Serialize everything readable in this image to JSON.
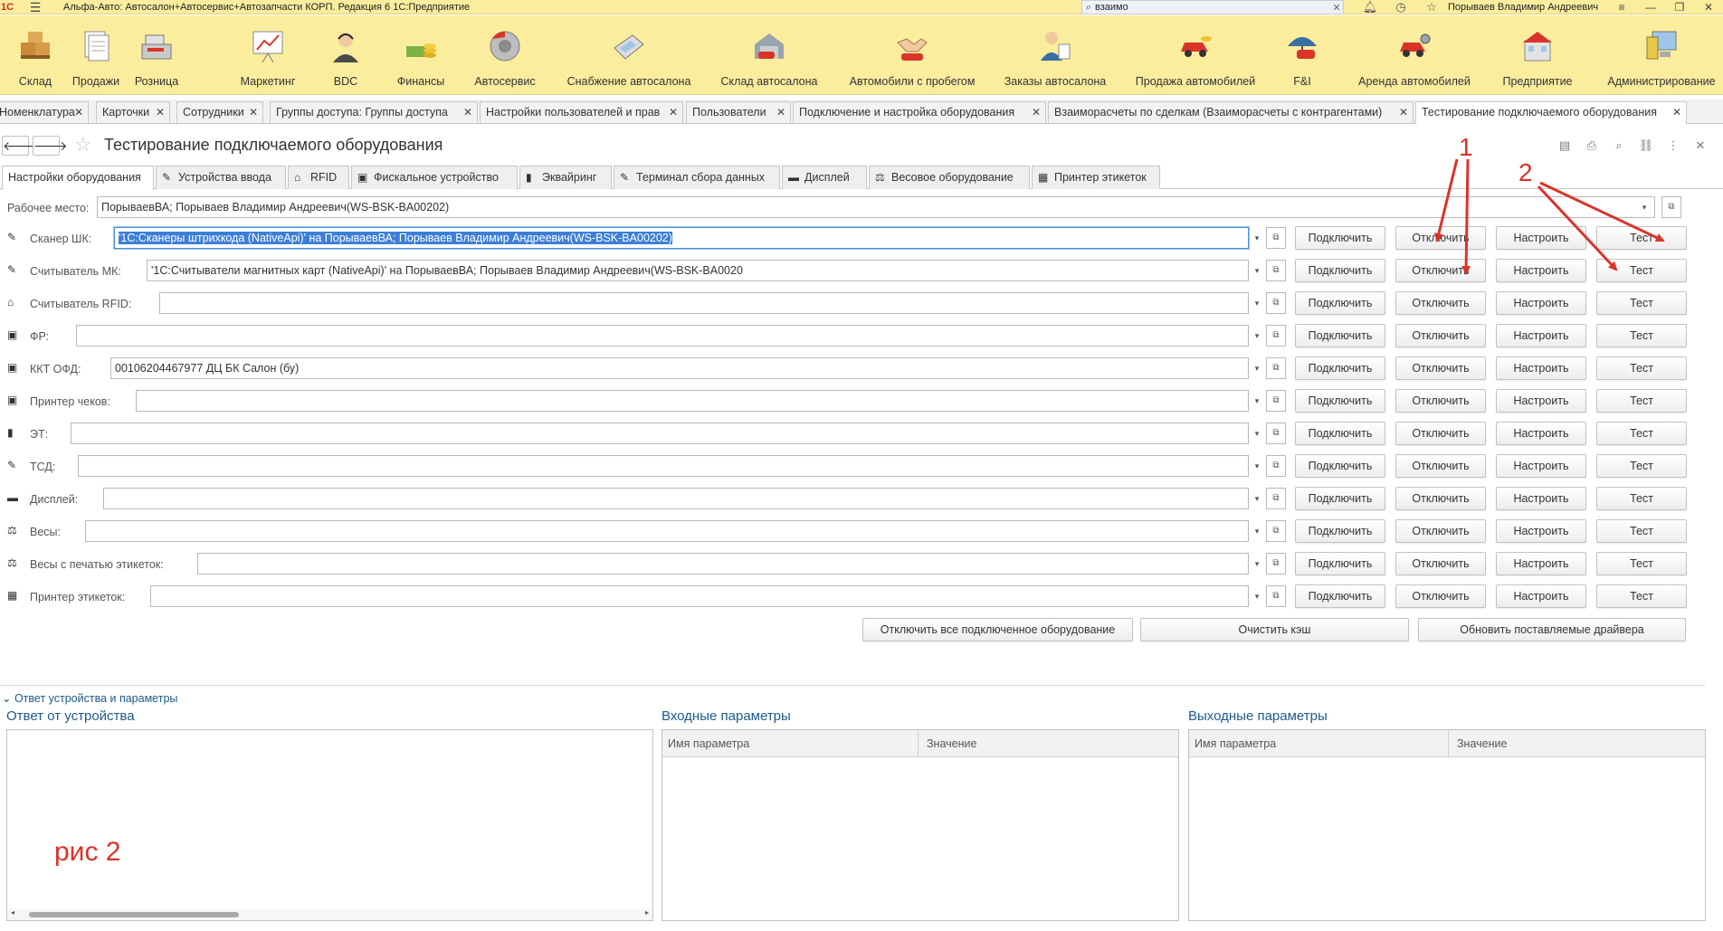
{
  "titlebar": {
    "logo": "1С",
    "title": "Альфа-Авто: Автосалон+Автосервис+Автозапчасти КОРП. Редакция 6 1С:Предприятие",
    "search_value": "взаимо",
    "user": "Порываев Владимир Андреевич"
  },
  "sections": [
    {
      "label": "Склад",
      "icon": "boxes-icon"
    },
    {
      "label": "Продажи",
      "icon": "documents-icon"
    },
    {
      "label": "Розница",
      "icon": "cash-register-icon"
    },
    {
      "label": "Маркетинг",
      "icon": "chart-board-icon"
    },
    {
      "label": "BDC",
      "icon": "operator-icon"
    },
    {
      "label": "Финансы",
      "icon": "coins-icon"
    },
    {
      "label": "Автосервис",
      "icon": "brake-disc-icon"
    },
    {
      "label": "Снабжение автосалона",
      "icon": "calculator-icon"
    },
    {
      "label": "Склад автосалона",
      "icon": "garage-icon"
    },
    {
      "label": "Автомобили с пробегом",
      "icon": "handshake-car-icon"
    },
    {
      "label": "Заказы автосалона",
      "icon": "person-order-icon"
    },
    {
      "label": "Продажа автомобилей",
      "icon": "car-money-icon"
    },
    {
      "label": "F&I",
      "icon": "umbrella-icon"
    },
    {
      "label": "Аренда автомобилей",
      "icon": "car-rent-icon"
    },
    {
      "label": "Предприятие",
      "icon": "building-icon"
    },
    {
      "label": "Администрирование",
      "icon": "computer-icon"
    }
  ],
  "open_tabs": [
    {
      "label": "Номенклатура"
    },
    {
      "label": "Карточки"
    },
    {
      "label": "Сотрудники"
    },
    {
      "label": "Группы доступа: Группы доступа"
    },
    {
      "label": "Настройки пользователей и прав"
    },
    {
      "label": "Пользователи"
    },
    {
      "label": "Подключение и настройка оборудования"
    },
    {
      "label": "Взаиморасчеты по сделкам (Взаиморасчеты с контрагентами)"
    },
    {
      "label": "Тестирование подключаемого оборудования"
    }
  ],
  "form": {
    "title": "Тестирование подключаемого оборудования"
  },
  "form_tabs": [
    {
      "label": "Настройки оборудования",
      "icon": ""
    },
    {
      "label": "Устройства ввода",
      "icon": "scanner-icon"
    },
    {
      "label": "RFID",
      "icon": "rfid-icon"
    },
    {
      "label": "Фискальное устройство",
      "icon": "fiscal-printer-icon"
    },
    {
      "label": "Эквайринг",
      "icon": "card-terminal-icon"
    },
    {
      "label": "Терминал сбора данных",
      "icon": "data-terminal-icon"
    },
    {
      "label": "Дисплей",
      "icon": "display-icon"
    },
    {
      "label": "Весовое оборудование",
      "icon": "scales-icon"
    },
    {
      "label": "Принтер этикеток",
      "icon": "label-printer-icon"
    }
  ],
  "workplace": {
    "label": "Рабочее место:",
    "value": "ПорываевВА; Порываев Владимир Андреевич(WS-BSK-BA00202)"
  },
  "buttons": {
    "connect": "Подключить",
    "disconnect": "Отключить",
    "setup": "Настроить",
    "test": "Тест"
  },
  "devices": [
    {
      "label": "Сканер ШК:",
      "value": "'1С:Сканеры штрихкода (NativeApi)' на ПорываевВА; Порываев Владимир Андреевич(WS-BSK-BA00202)",
      "icon": "barcode-scanner-icon"
    },
    {
      "label": "Считыватель МК:",
      "value": "'1С:Считыватели магнитных карт (NativeApi)' на ПорываевВА; Порываев Владимир Андреевич(WS-BSK-BA0020",
      "icon": "magnetic-card-reader-icon"
    },
    {
      "label": "Считыватель RFID:",
      "value": "",
      "icon": "rfid-reader-icon"
    },
    {
      "label": "ФР:",
      "value": "",
      "icon": "fiscal-registrar-icon"
    },
    {
      "label": "ККТ ОФД:",
      "value": "00106204467977 ДЦ БК Салон (бу)",
      "icon": "kkt-icon"
    },
    {
      "label": "Принтер чеков:",
      "value": "",
      "icon": "receipt-printer-icon"
    },
    {
      "label": "ЭТ:",
      "value": "",
      "icon": "acquiring-terminal-icon"
    },
    {
      "label": "ТСД:",
      "value": "",
      "icon": "data-collection-terminal-icon"
    },
    {
      "label": "Дисплей:",
      "value": "",
      "icon": "customer-display-icon"
    },
    {
      "label": "Весы:",
      "value": "",
      "icon": "scales-icon"
    },
    {
      "label": "Весы с печатью этикеток:",
      "value": "",
      "icon": "label-scales-icon"
    },
    {
      "label": "Принтер этикеток:",
      "value": "",
      "icon": "label-printer-icon"
    }
  ],
  "bottom_buttons": {
    "disconnect_all": "Отключить все подключенное оборудование",
    "clear_cache": "Очистить кэш",
    "update_drivers": "Обновить поставляемые драйвера"
  },
  "response_group": {
    "title": "Ответ устройства и параметры",
    "device_response": "Ответ от устройства",
    "input_params": "Входные параметры",
    "output_params": "Выходные параметры",
    "col_name": "Имя параметра",
    "col_value": "Значение"
  },
  "annotations": {
    "label_1": "1",
    "label_2": "2",
    "figure_caption": "рис 2",
    "color": "#d9342a"
  }
}
